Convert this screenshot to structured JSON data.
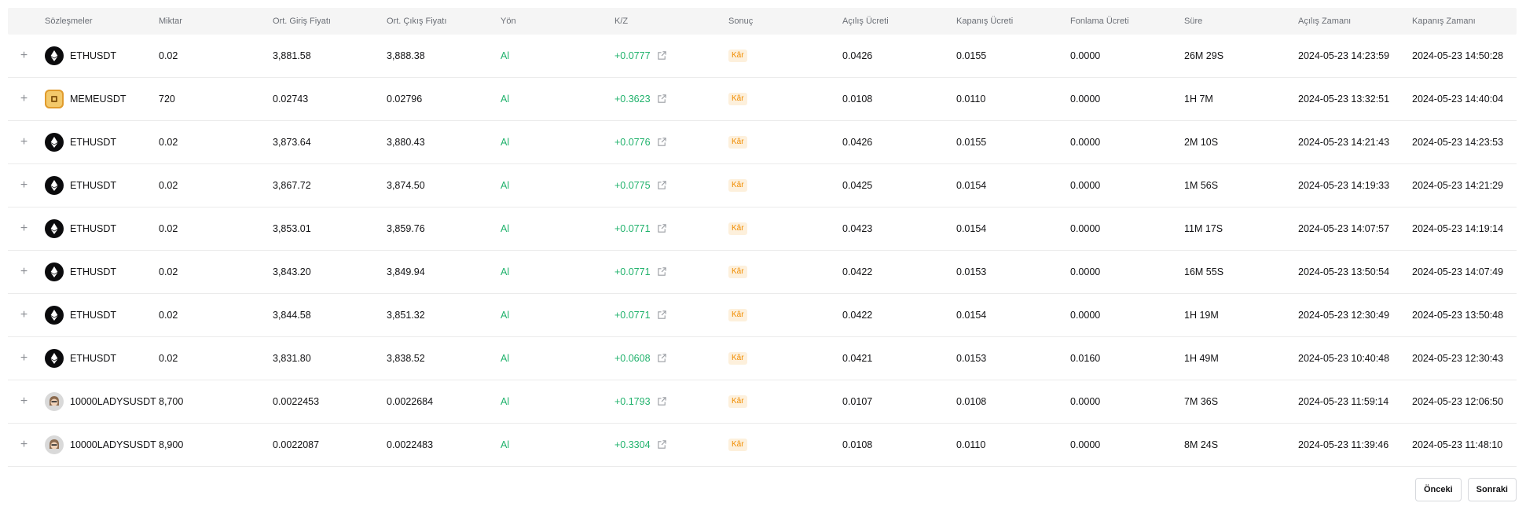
{
  "columns": [
    "Sözleşmeler",
    "Miktar",
    "Ort. Giriş Fiyatı",
    "Ort. Çıkış Fiyatı",
    "Yön",
    "K/Z",
    "Sonuç",
    "Açılış Ücreti",
    "Kapanış Ücreti",
    "Fonlama Ücreti",
    "Süre",
    "Açılış Zamanı",
    "Kapanış Zamanı"
  ],
  "colors": {
    "profit_green": "#20b26c",
    "badge_orange": "#f08c00",
    "badge_bg": "#fdf0dc"
  },
  "rows": [
    {
      "icon": "eth-coin-icon",
      "symbol": "ETHUSDT",
      "qty": "0.02",
      "entry": "3,881.58",
      "exit": "3,888.38",
      "side": "Al",
      "pnl": "+0.0777",
      "result": "Kâr",
      "open_fee": "0.0426",
      "close_fee": "0.0155",
      "funding_fee": "0.0000",
      "duration": "26M 29S",
      "open_time": "2024-05-23 14:23:59",
      "close_time": "2024-05-23 14:50:28"
    },
    {
      "icon": "meme-coin-icon",
      "symbol": "MEMEUSDT",
      "qty": "720",
      "entry": "0.02743",
      "exit": "0.02796",
      "side": "Al",
      "pnl": "+0.3623",
      "result": "Kâr",
      "open_fee": "0.0108",
      "close_fee": "0.0110",
      "funding_fee": "0.0000",
      "duration": "1H 7M",
      "open_time": "2024-05-23 13:32:51",
      "close_time": "2024-05-23 14:40:04"
    },
    {
      "icon": "eth-coin-icon",
      "symbol": "ETHUSDT",
      "qty": "0.02",
      "entry": "3,873.64",
      "exit": "3,880.43",
      "side": "Al",
      "pnl": "+0.0776",
      "result": "Kâr",
      "open_fee": "0.0426",
      "close_fee": "0.0155",
      "funding_fee": "0.0000",
      "duration": "2M 10S",
      "open_time": "2024-05-23 14:21:43",
      "close_time": "2024-05-23 14:23:53"
    },
    {
      "icon": "eth-coin-icon",
      "symbol": "ETHUSDT",
      "qty": "0.02",
      "entry": "3,867.72",
      "exit": "3,874.50",
      "side": "Al",
      "pnl": "+0.0775",
      "result": "Kâr",
      "open_fee": "0.0425",
      "close_fee": "0.0154",
      "funding_fee": "0.0000",
      "duration": "1M 56S",
      "open_time": "2024-05-23 14:19:33",
      "close_time": "2024-05-23 14:21:29"
    },
    {
      "icon": "eth-coin-icon",
      "symbol": "ETHUSDT",
      "qty": "0.02",
      "entry": "3,853.01",
      "exit": "3,859.76",
      "side": "Al",
      "pnl": "+0.0771",
      "result": "Kâr",
      "open_fee": "0.0423",
      "close_fee": "0.0154",
      "funding_fee": "0.0000",
      "duration": "11M 17S",
      "open_time": "2024-05-23 14:07:57",
      "close_time": "2024-05-23 14:19:14"
    },
    {
      "icon": "eth-coin-icon",
      "symbol": "ETHUSDT",
      "qty": "0.02",
      "entry": "3,843.20",
      "exit": "3,849.94",
      "side": "Al",
      "pnl": "+0.0771",
      "result": "Kâr",
      "open_fee": "0.0422",
      "close_fee": "0.0153",
      "funding_fee": "0.0000",
      "duration": "16M 55S",
      "open_time": "2024-05-23 13:50:54",
      "close_time": "2024-05-23 14:07:49"
    },
    {
      "icon": "eth-coin-icon",
      "symbol": "ETHUSDT",
      "qty": "0.02",
      "entry": "3,844.58",
      "exit": "3,851.32",
      "side": "Al",
      "pnl": "+0.0771",
      "result": "Kâr",
      "open_fee": "0.0422",
      "close_fee": "0.0154",
      "funding_fee": "0.0000",
      "duration": "1H 19M",
      "open_time": "2024-05-23 12:30:49",
      "close_time": "2024-05-23 13:50:48"
    },
    {
      "icon": "eth-coin-icon",
      "symbol": "ETHUSDT",
      "qty": "0.02",
      "entry": "3,831.80",
      "exit": "3,838.52",
      "side": "Al",
      "pnl": "+0.0608",
      "result": "Kâr",
      "open_fee": "0.0421",
      "close_fee": "0.0153",
      "funding_fee": "0.0160",
      "duration": "1H 49M",
      "open_time": "2024-05-23 10:40:48",
      "close_time": "2024-05-23 12:30:43"
    },
    {
      "icon": "ladys-coin-icon",
      "symbol": "10000LADYSUSDT",
      "qty": "8,700",
      "entry": "0.0022453",
      "exit": "0.0022684",
      "side": "Al",
      "pnl": "+0.1793",
      "result": "Kâr",
      "open_fee": "0.0107",
      "close_fee": "0.0108",
      "funding_fee": "0.0000",
      "duration": "7M 36S",
      "open_time": "2024-05-23 11:59:14",
      "close_time": "2024-05-23 12:06:50"
    },
    {
      "icon": "ladys-coin-icon",
      "symbol": "10000LADYSUSDT",
      "qty": "8,900",
      "entry": "0.0022087",
      "exit": "0.0022483",
      "side": "Al",
      "pnl": "+0.3304",
      "result": "Kâr",
      "open_fee": "0.0108",
      "close_fee": "0.0110",
      "funding_fee": "0.0000",
      "duration": "8M 24S",
      "open_time": "2024-05-23 11:39:46",
      "close_time": "2024-05-23 11:48:10"
    }
  ],
  "pagination": {
    "prev_label": "Önceki",
    "next_label": "Sonraki"
  }
}
